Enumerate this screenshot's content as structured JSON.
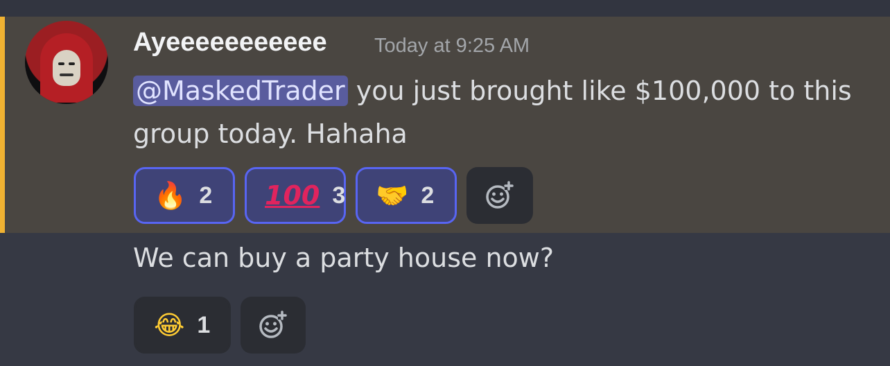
{
  "message": {
    "username": "Ayeeeeeeeeeee",
    "timestamp": "Today at 9:25 AM",
    "mention": "@MaskedTrader",
    "text": " you just brought like $100,000 to this group today. Hahaha",
    "reactions": [
      {
        "emoji_name": "fire-icon",
        "glyph": "🔥",
        "count": "2"
      },
      {
        "emoji_name": "hundred-points-icon",
        "glyph": "100",
        "count": "3"
      },
      {
        "emoji_name": "handshake-icon",
        "glyph": "🤝",
        "count": "2"
      }
    ]
  },
  "message2": {
    "text": "We can buy a party house now?",
    "reactions": [
      {
        "emoji_name": "tears-of-joy-icon",
        "glyph": "😂",
        "count": "1"
      }
    ]
  },
  "colors": {
    "highlight": "#4a4641",
    "accent_bar": "#f0b232",
    "mention_bg": "#595c9e",
    "reaction_active_border": "#5865f2",
    "background": "#363944"
  }
}
